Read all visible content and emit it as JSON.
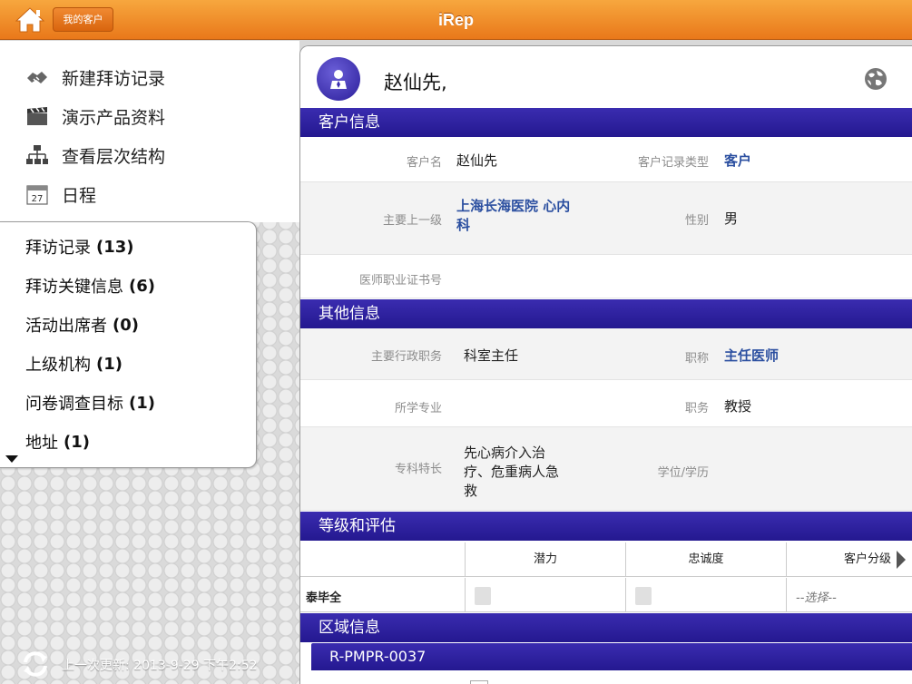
{
  "header": {
    "title": "iRep",
    "my_customers_label": "我的客户",
    "home_icon": "home-icon"
  },
  "sidebar": {
    "menu": [
      {
        "label": "新建拜访记录",
        "icon": "handshake-icon"
      },
      {
        "label": "演示产品资料",
        "icon": "clapperboard-icon"
      },
      {
        "label": "查看层次结构",
        "icon": "hierarchy-icon"
      },
      {
        "label": "日程",
        "icon": "calendar-icon",
        "calendar_day": "27"
      }
    ],
    "related": [
      {
        "label": "拜访记录",
        "count": "(13)"
      },
      {
        "label": "拜访关键信息",
        "count": "(6)"
      },
      {
        "label": "活动出席者",
        "count": "(0)"
      },
      {
        "label": "上级机构",
        "count": "(1)"
      },
      {
        "label": "问卷调查目标",
        "count": "(1)"
      },
      {
        "label": "地址",
        "count": "(1)"
      }
    ],
    "last_update": "上一次更新: 2013-9-29 下午2:52"
  },
  "detail": {
    "name": "赵仙先,",
    "sections": {
      "customer_info": "客户信息",
      "other_info": "其他信息",
      "rating": "等级和评估",
      "territory": "区域信息"
    },
    "customer_info": {
      "customer_name_label": "客户名",
      "customer_name": "赵仙先",
      "record_type_label": "客户记录类型",
      "record_type": "客户",
      "parent_label": "主要上一级",
      "parent_line1": "上海长海医院 心内",
      "parent_line2": "科",
      "gender_label": "性别",
      "gender": "男",
      "license_label": "医师职业证书号",
      "license": ""
    },
    "other_info": {
      "admin_title_label": "主要行政职务",
      "admin_title": "科室主任",
      "job_title_label": "职称",
      "job_title": "主任医师",
      "major_label": "所学专业",
      "major": "",
      "position_label": "职务",
      "position": "教授",
      "specialty_label": "专科特长",
      "specialty_line1": "先心病介入治",
      "specialty_line2": "疗、危重病人急",
      "specialty_line3": "救",
      "degree_label": "学位/学历",
      "degree": ""
    },
    "rating": {
      "columns": [
        "潜力",
        "忠诚度",
        "客户分级"
      ],
      "row_name": "泰毕全",
      "select_placeholder": "--选择--"
    },
    "territory": {
      "code": "R-PMPR-0037"
    }
  },
  "colors": {
    "topbar": "#f29a35",
    "section_header": "#2d1fa0",
    "link": "#2b4fa0"
  }
}
